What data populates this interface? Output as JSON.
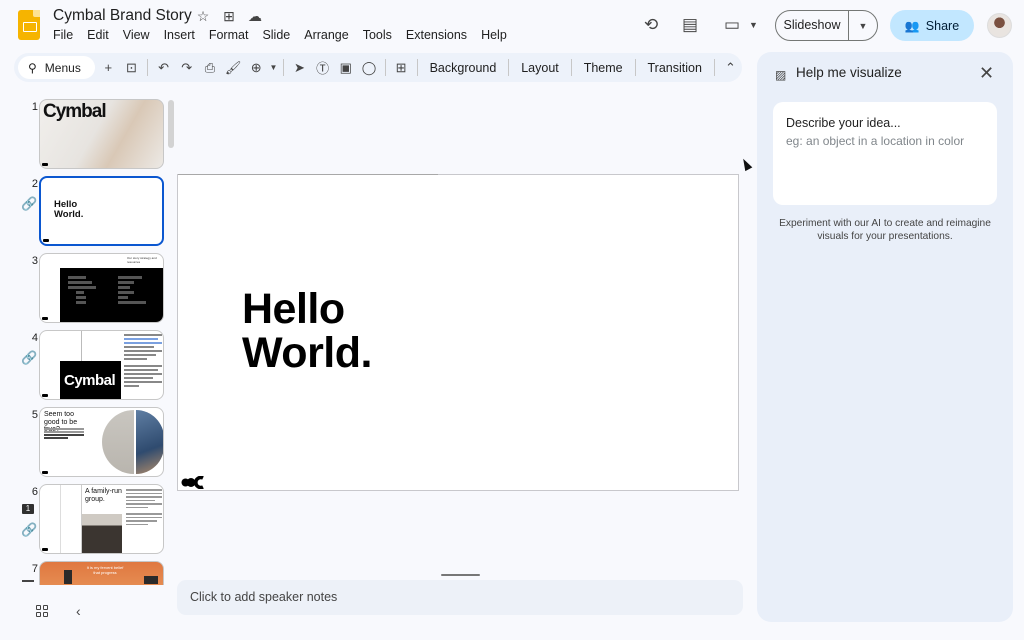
{
  "header": {
    "doc_title": "Cymbal Brand Story",
    "title_icons": [
      "star-icon",
      "move-folder-icon",
      "cloud-status-icon"
    ],
    "menu": [
      "File",
      "Edit",
      "View",
      "Insert",
      "Format",
      "Slide",
      "Arrange",
      "Tools",
      "Extensions",
      "Help"
    ],
    "right_icons": [
      "version-history-icon",
      "comments-icon",
      "meet-icon"
    ],
    "slideshow_label": "Slideshow",
    "share_label": "Share"
  },
  "toolbar": {
    "search_label": "Menus",
    "buttons": [
      "Background",
      "Layout",
      "Theme",
      "Transition"
    ]
  },
  "filmstrip": {
    "slides": [
      {
        "num": "1",
        "title": "Cymbal"
      },
      {
        "num": "2",
        "title": "Hello World.",
        "selected": true,
        "linked": true
      },
      {
        "num": "3",
        "title": "Our story strategy and resources",
        "toc_left": [
          "Our Story",
          "Cymbal Group",
          "Cymbal Business",
          "Kit",
          "Brand",
          "Voice"
        ],
        "toc_right": [
          "Design System",
          "Principles",
          "Devices",
          "Data Vis",
          "FAQs",
          "Submit Feedback"
        ]
      },
      {
        "num": "4",
        "title": "Cymbal",
        "linked": true
      },
      {
        "num": "5",
        "title": "Seem too good to be true?"
      },
      {
        "num": "6",
        "title": "A family-run group.",
        "comments": "1",
        "linked": true
      },
      {
        "num": "7",
        "title": "It is my fervent belief that progress"
      }
    ]
  },
  "canvas": {
    "slide_line1": "Hello",
    "slide_line2": "World.",
    "speaker_notes_placeholder": "Click to add speaker notes"
  },
  "side_panel": {
    "title": "Help me visualize",
    "input_label": "Describe your idea...",
    "input_placeholder": "eg: an object in a location in color",
    "description": "Experiment with our AI to create and reimagine visuals for your presentations."
  },
  "colors": {
    "accent": "#0b57d0",
    "share_bg": "#c2e7ff",
    "panel_bg": "#e9eff9",
    "app_yellow": "#f6b400"
  }
}
